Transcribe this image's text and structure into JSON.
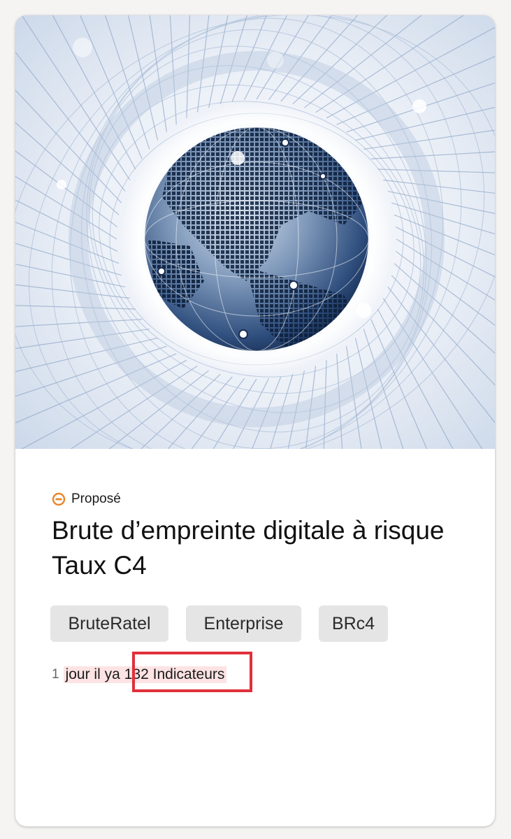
{
  "card": {
    "status": {
      "icon": "proposed-status-icon",
      "label": "Proposé",
      "color": "#e8862a"
    },
    "title": "Brute d’empreinte digitale à risque Taux C4",
    "tags": [
      {
        "label": "BruteRatel"
      },
      {
        "label": "Enterprise"
      },
      {
        "label": "BRc4"
      }
    ],
    "meta": {
      "count_prefix": "1",
      "age": "jour il ya",
      "indicators": "132 Indicateurs"
    },
    "highlight_color": "#e0303a",
    "hero_image": "globe-network-illustration"
  }
}
